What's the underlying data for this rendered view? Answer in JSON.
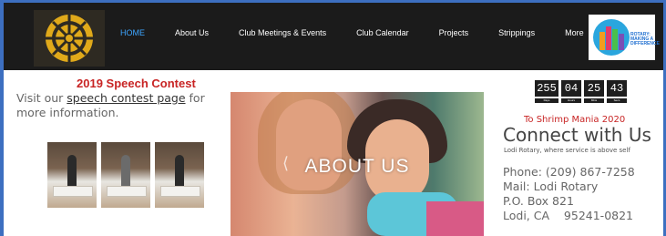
{
  "nav": {
    "items": [
      {
        "label": "HOME",
        "active": true
      },
      {
        "label": "About Us"
      },
      {
        "label": "Club Meetings & Events"
      },
      {
        "label": "Club Calendar"
      },
      {
        "label": "Projects"
      },
      {
        "label": "Strippings"
      },
      {
        "label": "More"
      }
    ],
    "badge_text": "ROTARY: MAKING A DIFFERENCE"
  },
  "contest": {
    "title": "2019 Speech Contest",
    "text_before": "Visit our ",
    "link": "speech contest page",
    "text_after": " for more information."
  },
  "hero": {
    "title": "ABOUT US",
    "arrow": "⟨"
  },
  "countdown": {
    "values": [
      "255",
      "04",
      "25",
      "43"
    ],
    "labels": [
      "Days",
      "Hours",
      "Mins",
      "Secs"
    ],
    "caption": "To Shrimp Mania 2020"
  },
  "connect": {
    "title": "Connect with Us",
    "subtitle": "Lodi Rotary, where service is above self",
    "phone": "Phone: (209) 867-7258",
    "mail": "Mail: Lodi Rotary",
    "po": "P.O. Box 821",
    "city": "Lodi, CA    95241-0821"
  },
  "colors": {
    "nav_bg": "#1b1b1b",
    "nav_active": "#3da5ff",
    "accent_red": "#c82424",
    "frame": "#3d6fc0"
  }
}
